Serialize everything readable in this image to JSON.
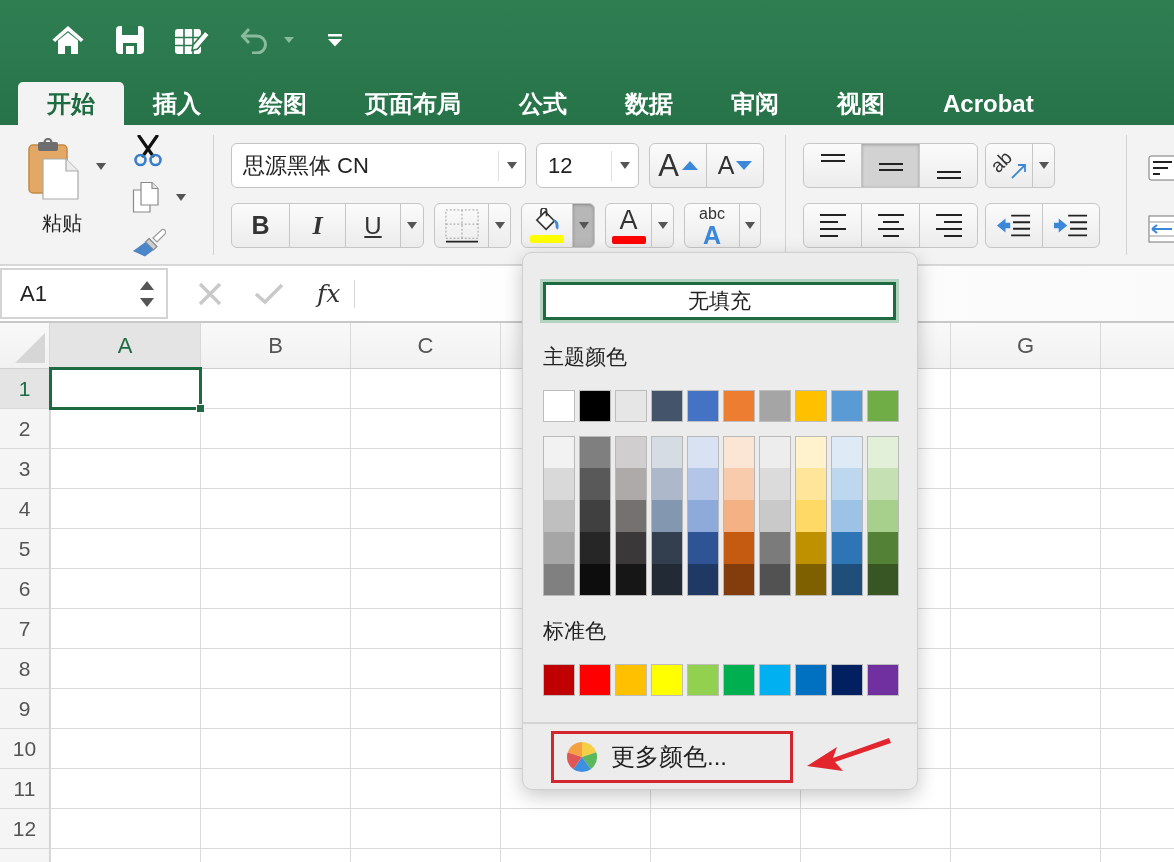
{
  "quick_access": [
    {
      "kind": "home",
      "disabled": false
    },
    {
      "kind": "save",
      "disabled": false
    },
    {
      "kind": "edit",
      "disabled": false
    },
    {
      "kind": "undo",
      "disabled": true
    },
    {
      "kind": "customize",
      "disabled": false
    }
  ],
  "tabs": [
    {
      "label": "开始",
      "selected": true
    },
    {
      "label": "插入",
      "selected": false
    },
    {
      "label": "绘图",
      "selected": false
    },
    {
      "label": "页面布局",
      "selected": false
    },
    {
      "label": "公式",
      "selected": false
    },
    {
      "label": "数据",
      "selected": false
    },
    {
      "label": "审阅",
      "selected": false
    },
    {
      "label": "视图",
      "selected": false
    },
    {
      "label": "Acrobat",
      "selected": false
    }
  ],
  "ribbon": {
    "paste_label": "粘贴",
    "font_name": "思源黑体 CN",
    "font_size": "12",
    "size_buttons": [
      {
        "kind": "grow",
        "glyph": "A"
      },
      {
        "kind": "shrink",
        "glyph": "A"
      }
    ],
    "style_buttons": [
      {
        "kind": "bold",
        "label": "B",
        "selected": false
      },
      {
        "kind": "italic",
        "label": "I",
        "selected": false
      },
      {
        "kind": "underline",
        "label": "U",
        "selected": false
      }
    ],
    "fill_color": {
      "color": "#ffff00",
      "menu_open": true
    },
    "font_color": {
      "glyph": "A",
      "color": "#ff0000"
    },
    "text_effects": {
      "top": "abc",
      "bottom": "A"
    },
    "vertical_align": [
      {
        "kind": "top",
        "selected": false
      },
      {
        "kind": "middle",
        "selected": true
      },
      {
        "kind": "bottom",
        "selected": false
      }
    ],
    "orientation": {
      "glyph": "ab"
    },
    "horizontal_align": [
      {
        "kind": "left",
        "selected": false
      },
      {
        "kind": "center",
        "selected": false
      },
      {
        "kind": "right",
        "selected": false
      }
    ],
    "indent": [
      {
        "kind": "decrease"
      },
      {
        "kind": "increase"
      }
    ]
  },
  "formula_bar": {
    "name_box": "A1",
    "cancel_disabled": true,
    "enter_disabled": true,
    "function_label": "fx"
  },
  "grid": {
    "columns": [
      {
        "kind": "header",
        "label": "A",
        "selected": true
      },
      {
        "kind": "header",
        "label": "B",
        "selected": false
      },
      {
        "kind": "header",
        "label": "C",
        "selected": false
      },
      {
        "kind": "blank"
      },
      {
        "kind": "blank"
      },
      {
        "kind": "blank"
      },
      {
        "kind": "header",
        "label": "G",
        "selected": false
      },
      {
        "kind": "blank"
      }
    ],
    "rows": [
      {
        "kind": "header",
        "label": "1",
        "selected": true
      },
      {
        "kind": "header",
        "label": "2",
        "selected": false
      },
      {
        "kind": "header",
        "label": "3",
        "selected": false
      },
      {
        "kind": "header",
        "label": "4",
        "selected": false
      },
      {
        "kind": "header",
        "label": "5",
        "selected": false
      },
      {
        "kind": "header",
        "label": "6",
        "selected": false
      },
      {
        "kind": "header",
        "label": "7",
        "selected": false
      },
      {
        "kind": "header",
        "label": "8",
        "selected": false
      },
      {
        "kind": "header",
        "label": "9",
        "selected": false
      },
      {
        "kind": "header",
        "label": "10",
        "selected": false
      },
      {
        "kind": "header",
        "label": "11",
        "selected": false
      },
      {
        "kind": "header",
        "label": "12",
        "selected": false
      },
      {
        "kind": "blank"
      }
    ]
  },
  "fill_menu": {
    "no_fill": {
      "label": "无填充",
      "focused": true
    },
    "theme_heading": "主题颜色",
    "theme_colors": [
      {
        "color": "#ffffff"
      },
      {
        "color": "#000000"
      },
      {
        "color": "#e7e6e6"
      },
      {
        "color": "#44546a"
      },
      {
        "color": "#4472c4"
      },
      {
        "color": "#ed7d31"
      },
      {
        "color": "#a5a5a5"
      },
      {
        "color": "#ffc000"
      },
      {
        "color": "#5b9bd5"
      },
      {
        "color": "#70ad47"
      }
    ],
    "theme_shades": [
      {
        "shades": [
          {
            "color": "#f2f2f2"
          },
          {
            "color": "#d9d9d9"
          },
          {
            "color": "#bfbfbf"
          },
          {
            "color": "#a6a6a6"
          },
          {
            "color": "#808080"
          }
        ]
      },
      {
        "shades": [
          {
            "color": "#7f7f7f"
          },
          {
            "color": "#595959"
          },
          {
            "color": "#404040"
          },
          {
            "color": "#262626"
          },
          {
            "color": "#0d0d0d"
          }
        ]
      },
      {
        "shades": [
          {
            "color": "#d0cece"
          },
          {
            "color": "#aeaaaa"
          },
          {
            "color": "#757171"
          },
          {
            "color": "#3a3838"
          },
          {
            "color": "#161616"
          }
        ]
      },
      {
        "shades": [
          {
            "color": "#d6dce4"
          },
          {
            "color": "#adb9ca"
          },
          {
            "color": "#8497b0"
          },
          {
            "color": "#333f4f"
          },
          {
            "color": "#222a35"
          }
        ]
      },
      {
        "shades": [
          {
            "color": "#d9e2f3"
          },
          {
            "color": "#b4c6e7"
          },
          {
            "color": "#8eaadb"
          },
          {
            "color": "#2f5496"
          },
          {
            "color": "#1f3864"
          }
        ]
      },
      {
        "shades": [
          {
            "color": "#fbe5d5"
          },
          {
            "color": "#f7cbac"
          },
          {
            "color": "#f4b183"
          },
          {
            "color": "#c55a11"
          },
          {
            "color": "#833c0b"
          }
        ]
      },
      {
        "shades": [
          {
            "color": "#ededed"
          },
          {
            "color": "#dbdbdb"
          },
          {
            "color": "#c9c9c9"
          },
          {
            "color": "#7b7b7b"
          },
          {
            "color": "#525252"
          }
        ]
      },
      {
        "shades": [
          {
            "color": "#fff2cc"
          },
          {
            "color": "#fee599"
          },
          {
            "color": "#ffd965"
          },
          {
            "color": "#bf9000"
          },
          {
            "color": "#7f6000"
          }
        ]
      },
      {
        "shades": [
          {
            "color": "#deebf6"
          },
          {
            "color": "#bdd7ee"
          },
          {
            "color": "#9cc3e5"
          },
          {
            "color": "#2e75b5"
          },
          {
            "color": "#1e4e79"
          }
        ]
      },
      {
        "shades": [
          {
            "color": "#e2efd9"
          },
          {
            "color": "#c5e0b3"
          },
          {
            "color": "#a8d08d"
          },
          {
            "color": "#538135"
          },
          {
            "color": "#375623"
          }
        ]
      }
    ],
    "standard_heading": "标准色",
    "standard_colors": [
      {
        "color": "#c00000"
      },
      {
        "color": "#ff0000"
      },
      {
        "color": "#ffc000"
      },
      {
        "color": "#ffff00"
      },
      {
        "color": "#92d050"
      },
      {
        "color": "#00b050"
      },
      {
        "color": "#00b0f0"
      },
      {
        "color": "#0070c0"
      },
      {
        "color": "#002060"
      },
      {
        "color": "#7030a0"
      }
    ],
    "more_colors": {
      "label": "更多颜色...",
      "highlighted": true
    },
    "pointer_arrow": true
  }
}
